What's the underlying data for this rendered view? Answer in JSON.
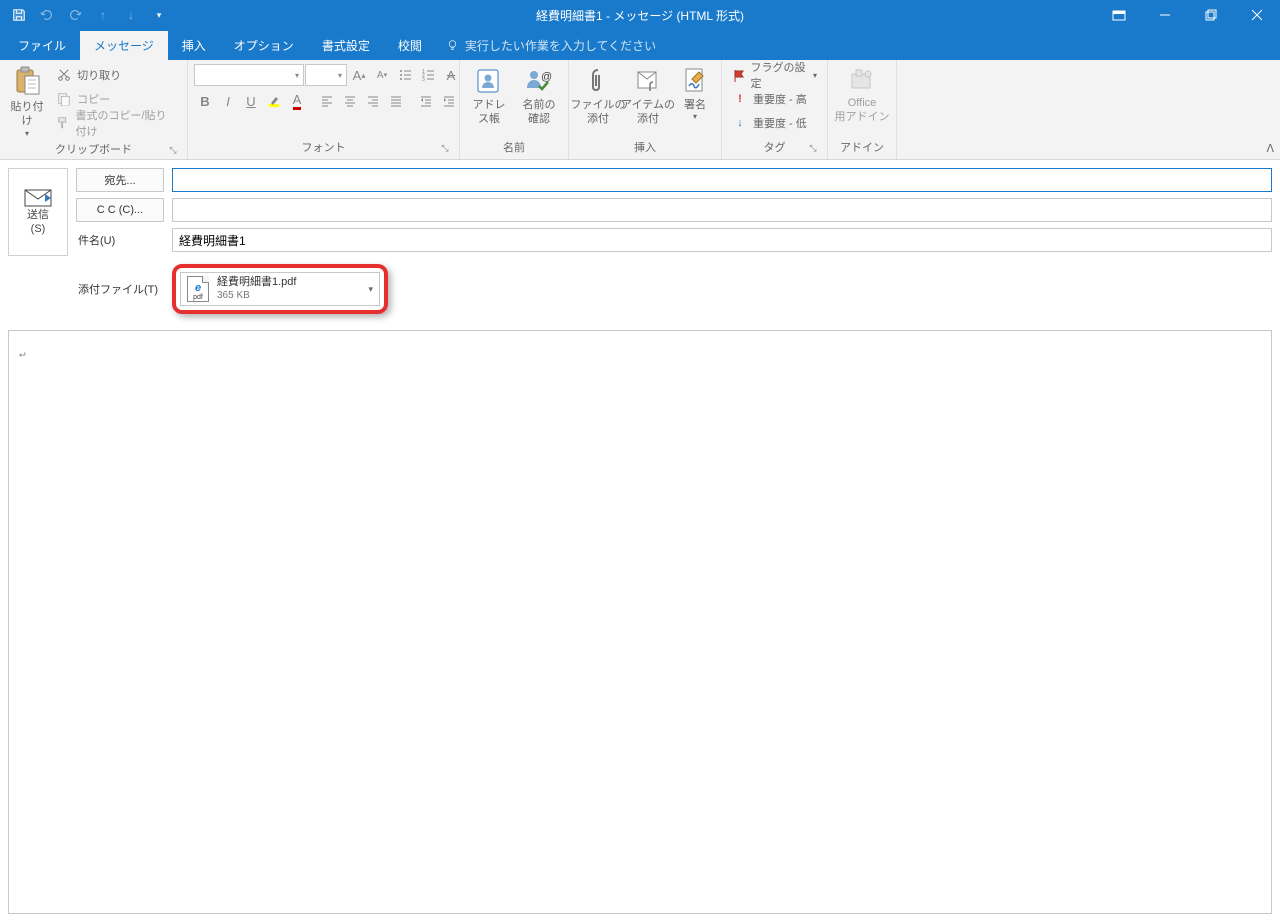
{
  "window": {
    "title": "経費明細書1  -  メッセージ (HTML 形式)"
  },
  "tabs": {
    "file": "ファイル",
    "message": "メッセージ",
    "insert": "挿入",
    "options": "オプション",
    "format": "書式設定",
    "review": "校閲",
    "tellme": "実行したい作業を入力してください"
  },
  "ribbon": {
    "clipboard": {
      "paste": "貼り付け",
      "cut": "切り取り",
      "copy": "コピー",
      "painter": "書式のコピー/貼り付け",
      "label": "クリップボード"
    },
    "font": {
      "label": "フォント"
    },
    "names": {
      "addressbook": "アドレス帳",
      "checknames": "名前の\n確認",
      "label": "名前"
    },
    "include": {
      "attachfile": "ファイルの\n添付",
      "attachitem": "アイテムの\n添付",
      "signature": "署名",
      "label": "挿入"
    },
    "tags": {
      "followup": "フラグの設定",
      "high": "重要度 - 高",
      "low": "重要度 - 低",
      "label": "タグ"
    },
    "addins": {
      "office": "Office\n用アドイン",
      "label": "アドイン"
    }
  },
  "compose": {
    "send": "送信\n(S)",
    "to": "宛先...",
    "cc": "C C (C)...",
    "subject_label": "件名(U)",
    "subject_value": "経費明細書1",
    "attach_label": "添付ファイル(T)"
  },
  "attachment": {
    "name": "経費明細書1.pdf",
    "size": "365 KB",
    "ext": "pdf"
  },
  "body": {
    "placeholder": "↵"
  }
}
